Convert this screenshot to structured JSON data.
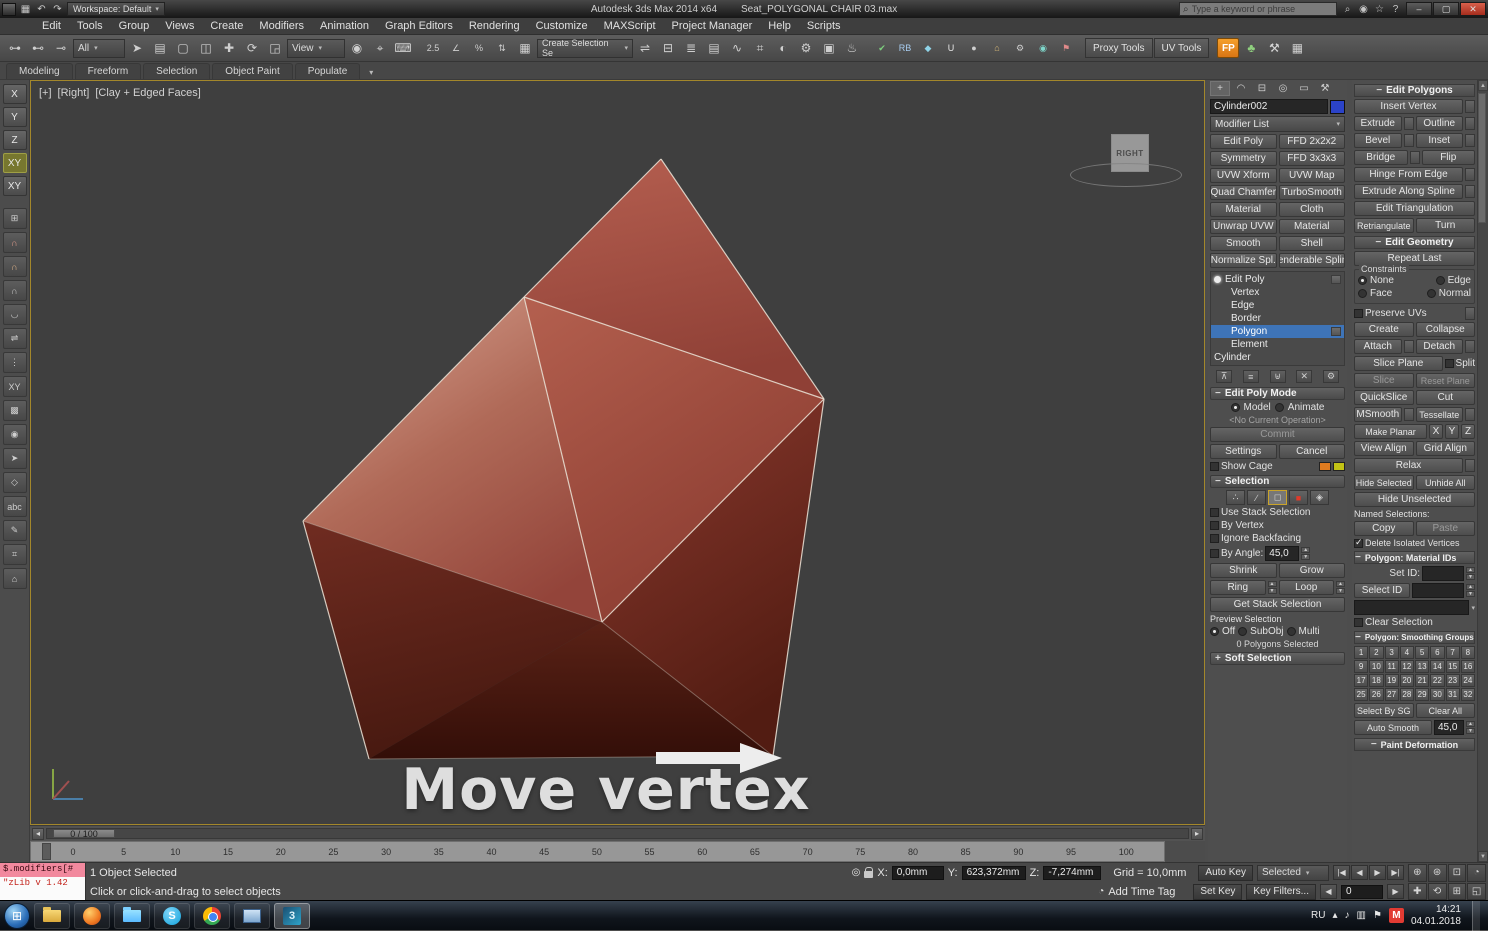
{
  "colors": {
    "accent_blue": "#3e74b8",
    "shape_red": "#a04a3c",
    "viewport_border": "#a3872b",
    "close_red": "#c03a2b",
    "polygon_mode_red": "#e03a2a"
  },
  "titlebar": {
    "app_title": "Autodesk 3ds Max 2014 x64",
    "doc_title": "Seat_POLYGONAL CHAIR 03.max",
    "workspace": "Workspace: Default",
    "search_placeholder": "Type a keyword or phrase",
    "quick_icons": [
      {
        "n": "app-menu-icon",
        "g": "▦"
      },
      {
        "n": "undo-quick-icon",
        "g": "↶"
      },
      {
        "n": "redo-quick-icon",
        "g": "↷"
      }
    ],
    "right_icons": [
      {
        "n": "search-go-icon",
        "g": "⌕"
      },
      {
        "n": "sign-in-icon",
        "g": "◉"
      },
      {
        "n": "favorites-icon",
        "g": "☆"
      },
      {
        "n": "help-icon",
        "g": "?"
      }
    ],
    "window_controls": [
      {
        "n": "minimize-button",
        "g": "–"
      },
      {
        "n": "maximize-button",
        "g": "▢"
      },
      {
        "n": "close-button",
        "g": "✕"
      }
    ]
  },
  "menubar": {
    "items": [
      "Edit",
      "Tools",
      "Group",
      "Views",
      "Create",
      "Modifiers",
      "Animation",
      "Graph Editors",
      "Rendering",
      "Customize",
      "MAXScript",
      "Project Manager",
      "Help",
      "Scripts"
    ]
  },
  "toolbar": {
    "selection_filter": "All",
    "reference_coord": "View",
    "named_sets_placeholder": "Create Selection Se",
    "proxy_tools": "Proxy Tools",
    "uv_tools": "UV Tools",
    "fp_badge": "FP",
    "link_icons": [
      {
        "n": "select-and-link-icon",
        "g": "⊶"
      },
      {
        "n": "unlink-selection-icon",
        "g": "⊷"
      },
      {
        "n": "bind-to-spacewarp-icon",
        "g": "⊸"
      }
    ],
    "select_icons": [
      {
        "n": "select-object-icon",
        "g": "➤"
      },
      {
        "n": "select-by-name-icon",
        "g": "▤"
      },
      {
        "n": "rect-selection-icon",
        "g": "▢"
      },
      {
        "n": "window-crossing-icon",
        "g": "◫"
      }
    ],
    "transform_icons": [
      {
        "n": "select-and-move-icon",
        "g": "✚"
      },
      {
        "n": "select-and-rotate-icon",
        "g": "⟳"
      },
      {
        "n": "select-and-scale-icon",
        "g": "◲"
      }
    ],
    "pivot_icons": [
      {
        "n": "use-pivot-center-icon",
        "g": "◉"
      },
      {
        "n": "select-and-manipulate-icon",
        "g": "⌖"
      },
      {
        "n": "keyboard-override-icon",
        "g": "⌨"
      }
    ],
    "snap_icons": [
      {
        "n": "snap-toggle-icon",
        "g": "2.5"
      },
      {
        "n": "angle-snap-icon",
        "g": "∠"
      },
      {
        "n": "percent-snap-icon",
        "g": "%"
      },
      {
        "n": "spinner-snap-icon",
        "g": "⇅"
      }
    ],
    "sets_icons": [
      {
        "n": "edit-named-sets-icon",
        "g": "▦"
      }
    ],
    "tool_icons": [
      {
        "n": "mirror-icon",
        "g": "⇌"
      },
      {
        "n": "align-icon",
        "g": "⊟"
      },
      {
        "n": "layer-manager-icon",
        "g": "≣"
      },
      {
        "n": "ribbon-toggle-icon",
        "g": "▤"
      },
      {
        "n": "curve-editor-icon",
        "g": "∿"
      },
      {
        "n": "schematic-view-icon",
        "g": "⌗"
      },
      {
        "n": "material-editor-icon",
        "g": "◐"
      },
      {
        "n": "render-setup-icon",
        "g": "⚙"
      },
      {
        "n": "rendered-frame-icon",
        "g": "▣"
      },
      {
        "n": "render-production-icon",
        "g": "♨"
      }
    ],
    "plugin_icons": [
      {
        "n": "vray-check-icon",
        "g": "✔",
        "c": "#7ed07e"
      },
      {
        "n": "rb-plugin-icon",
        "g": "RB",
        "c": "#a8cdf0"
      },
      {
        "n": "diamond-plugin-icon",
        "g": "◆",
        "c": "#8fd4e8"
      },
      {
        "n": "unwrella-icon",
        "g": "U",
        "c": "#e8e8e8"
      },
      {
        "n": "sphere-plugin-icon",
        "g": "●",
        "c": "#cfcfcf"
      },
      {
        "n": "relink-plugin-icon",
        "g": "⌂",
        "c": "#d8b978"
      },
      {
        "n": "gear-plugin-icon",
        "g": "⚙",
        "c": "#d0d0d0"
      },
      {
        "n": "teal-plugin-icon",
        "g": "◉",
        "c": "#7fd8cc"
      },
      {
        "n": "locator-plugin-icon",
        "g": "⚑",
        "c": "#e08a8a"
      }
    ],
    "end_icons": [
      {
        "n": "forest-pack-icon",
        "g": "♣",
        "c": "#8fd07e"
      },
      {
        "n": "wrench-tool-icon",
        "g": "⚒",
        "c": "#d8d8d8"
      },
      {
        "n": "grid-tool-icon",
        "g": "▦",
        "c": "#cfcfcf"
      }
    ]
  },
  "ribbon": {
    "tabs": [
      "Modeling",
      "Freeform",
      "Selection",
      "Object Paint",
      "Populate"
    ]
  },
  "left_toolbar": {
    "axis_buttons": [
      "X",
      "Y",
      "Z",
      "XY",
      "XY"
    ],
    "tool_icons": [
      {
        "n": "grid-snap-icon",
        "g": "⊞"
      },
      {
        "n": "magnet-3-icon",
        "g": "∩",
        "c": "#e09a8a"
      },
      {
        "n": "magnet-25-icon",
        "g": "∩",
        "c": "#e0b48a"
      },
      {
        "n": "magnet-2-icon",
        "g": "∩",
        "c": "#c8c8c8"
      },
      {
        "n": "snap-settings-icon",
        "g": "◡"
      },
      {
        "n": "mirror-small-icon",
        "g": "⇌"
      },
      {
        "n": "array-small-icon",
        "g": "⋮"
      },
      {
        "n": "xy-small-icon",
        "g": "XY"
      },
      {
        "n": "checker-small-icon",
        "g": "▩"
      },
      {
        "n": "camera-small-icon",
        "g": "◉"
      },
      {
        "n": "cursor-small-icon",
        "g": "➤"
      },
      {
        "n": "faces-small-icon",
        "g": "◇"
      },
      {
        "n": "spell-check-icon",
        "g": "abc"
      },
      {
        "n": "pencil-small-icon",
        "g": "✎"
      },
      {
        "n": "measure-small-icon",
        "g": "⌗"
      },
      {
        "n": "home-small-icon",
        "g": "⌂"
      }
    ]
  },
  "viewport": {
    "label_plus": "[+]",
    "label_view": "[Right]",
    "label_shading": "[Clay + Edged Faces]",
    "viewcube": "RIGHT",
    "overlay": "Move vertex",
    "time_slider": "0 / 100",
    "ruler": [
      "0",
      "5",
      "10",
      "15",
      "20",
      "25",
      "30",
      "35",
      "40",
      "45",
      "50",
      "55",
      "60",
      "65",
      "70",
      "75",
      "80",
      "85",
      "90",
      "95",
      "100"
    ]
  },
  "command_panel": {
    "tabs": [
      {
        "n": "create-tab-icon",
        "g": "+"
      },
      {
        "n": "modify-tab-icon",
        "g": "◠"
      },
      {
        "n": "hierarchy-tab-icon",
        "g": "⊟"
      },
      {
        "n": "motion-tab-icon",
        "g": "◎"
      },
      {
        "n": "display-tab-icon",
        "g": "▭"
      },
      {
        "n": "utilities-tab-icon",
        "g": "⚒"
      }
    ],
    "object_name": "Cylinder002",
    "modifier_list": "Modifier List",
    "modifier_sets": [
      "Edit Poly",
      "FFD 2x2x2",
      "Symmetry",
      "FFD 3x3x3",
      "UVW Xform",
      "UVW Map",
      "Quad Chamfer",
      "TurboSmooth",
      "Material",
      "Cloth",
      "Unwrap UVW",
      "Material",
      "Smooth",
      "Shell",
      "Normalize Spl.",
      "Renderable Spline"
    ],
    "stack": [
      "Edit Poly",
      "Vertex",
      "Edge",
      "Border",
      "Polygon",
      "Element",
      "Cylinder"
    ],
    "stack_tools": [
      {
        "n": "pin-stack-icon",
        "g": "⊼"
      },
      {
        "n": "show-end-result-icon",
        "g": "≡"
      },
      {
        "n": "make-unique-icon",
        "g": "⊎"
      },
      {
        "n": "remove-modifier-icon",
        "g": "✕"
      },
      {
        "n": "configure-sets-icon",
        "g": "⚙"
      }
    ],
    "mode": {
      "title": "Edit Poly Mode",
      "model": "Model",
      "animate": "Animate",
      "operation": "<No Current Operation>",
      "commit": "Commit",
      "settings": "Settings",
      "cancel": "Cancel",
      "show_cage": "Show Cage"
    },
    "selection": {
      "title": "Selection",
      "mode_icons": [
        {
          "n": "vertex-mode-icon",
          "g": "∴"
        },
        {
          "n": "edge-mode-icon",
          "g": "∕"
        },
        {
          "n": "border-mode-icon",
          "g": "◻"
        },
        {
          "n": "polygon-mode-icon",
          "g": "■",
          "c": "#e03a2a"
        },
        {
          "n": "element-mode-icon",
          "g": "◈"
        }
      ],
      "cb1": "Use Stack Selection",
      "cb2": "By Vertex",
      "cb3": "Ignore Backfacing",
      "by_angle": "By Angle:",
      "angle_value": "45,0",
      "shrink": "Shrink",
      "grow": "Grow",
      "ring": "Ring",
      "loop": "Loop",
      "get_stack": "Get Stack Selection",
      "preview": "Preview Selection",
      "off": "Off",
      "subobj": "SubObj",
      "multi": "Multi",
      "status": "0 Polygons Selected"
    },
    "soft_selection": "Soft Selection"
  },
  "edit_polygons": {
    "title": "Edit Polygons",
    "insert_vertex": "Insert Vertex",
    "extrude": "Extrude",
    "outline": "Outline",
    "bevel": "Bevel",
    "inset": "Inset",
    "bridge": "Bridge",
    "flip": "Flip",
    "hinge": "Hinge From Edge",
    "extrude_spline": "Extrude Along Spline",
    "edit_tri": "Edit Triangulation",
    "retriangulate": "Retriangulate",
    "turn": "Turn",
    "geometry_title": "Edit Geometry",
    "repeat_last": "Repeat Last",
    "constraints": "Constraints",
    "none": "None",
    "edge": "Edge",
    "face": "Face",
    "normal": "Normal",
    "preserve_uvs": "Preserve UVs",
    "create": "Create",
    "collapse": "Collapse",
    "attach": "Attach",
    "detach": "Detach",
    "slice_plane": "Slice Plane",
    "split": "Split",
    "slice": "Slice",
    "reset_plane": "Reset Plane",
    "quickslice": "QuickSlice",
    "cut": "Cut",
    "msmooth": "MSmooth",
    "tessellate": "Tessellate",
    "make_planar": "Make Planar",
    "x": "X",
    "y": "Y",
    "z": "Z",
    "view_align": "View Align",
    "grid_align": "Grid Align",
    "relax": "Relax",
    "hide_selected": "Hide Selected",
    "unhide_all": "Unhide All",
    "hide_unselected": "Hide Unselected",
    "named_selections": "Named Selections:",
    "copy": "Copy",
    "paste": "Paste",
    "delete_isolated": "Delete Isolated Vertices",
    "material_ids_title": "Polygon: Material IDs",
    "set_id": "Set ID:",
    "select_id": "Select ID",
    "clear_selection": "Clear Selection",
    "smoothing_title": "Polygon: Smoothing Groups",
    "smoothing_groups": [
      "1",
      "2",
      "3",
      "4",
      "5",
      "6",
      "7",
      "8",
      "9",
      "10",
      "11",
      "12",
      "13",
      "14",
      "15",
      "16",
      "17",
      "18",
      "19",
      "20",
      "21",
      "22",
      "23",
      "24",
      "25",
      "26",
      "27",
      "28",
      "29",
      "30",
      "31",
      "32"
    ],
    "select_by_sg": "Select By SG",
    "clear_all": "Clear All",
    "auto_smooth": "Auto Smooth",
    "auto_smooth_value": "45,0",
    "paint_deformation": "Paint Deformation"
  },
  "status_bar": {
    "listener_macro": "$.modifiers[#",
    "listener_line": "\"zLib v 1.42",
    "selected": "1 Object Selected",
    "prompt": "Click or click-and-drag to select objects",
    "x_label": "X:",
    "x": "0,0mm",
    "y_label": "Y:",
    "y": "623,372mm",
    "z_label": "Z:",
    "z": "-7,274mm",
    "grid": "Grid = 10,0mm",
    "add_time_tag": "Add Time Tag",
    "auto_key": "Auto Key",
    "set_key": "Set Key",
    "selected_filter": "Selected",
    "key_filters": "Key Filters...",
    "time_value": "0",
    "playback": [
      {
        "n": "go-start-button",
        "g": "|◀"
      },
      {
        "n": "prev-frame-button",
        "g": "◀"
      },
      {
        "n": "play-button",
        "g": "▶"
      },
      {
        "n": "go-end-button",
        "g": "▶|"
      }
    ],
    "nav": [
      {
        "n": "zoom-icon",
        "g": "⊕"
      },
      {
        "n": "zoom-all-icon",
        "g": "⊛"
      },
      {
        "n": "zoom-extents-icon",
        "g": "⊡"
      },
      {
        "n": "fov-icon",
        "g": "◔"
      },
      {
        "n": "pan-icon",
        "g": "✚"
      },
      {
        "n": "orbit-icon",
        "g": "⟲"
      },
      {
        "n": "zoom-region-icon",
        "g": "⊞"
      },
      {
        "n": "maximize-viewport-icon",
        "g": "◱"
      }
    ]
  },
  "taskbar": {
    "language": "RU",
    "time": "14:21",
    "date": "04.01.2018"
  }
}
